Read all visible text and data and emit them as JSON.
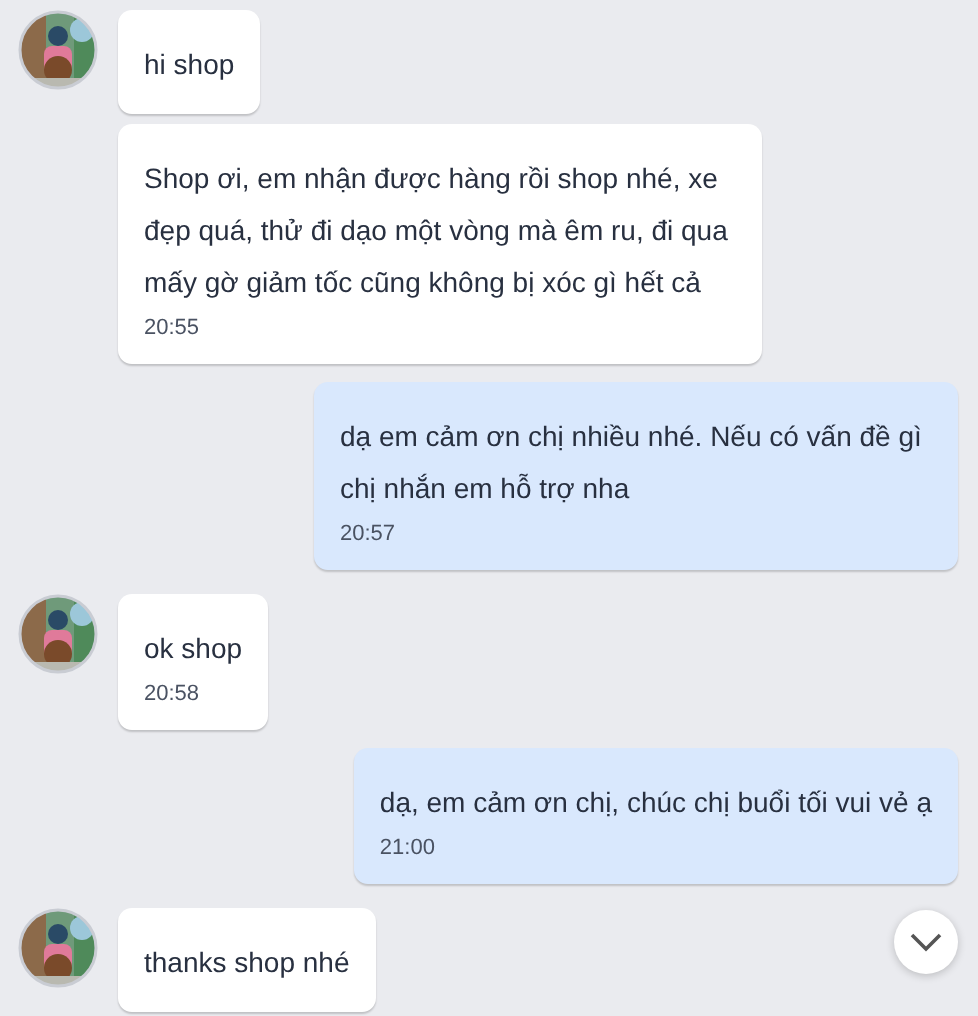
{
  "messages": [
    {
      "kind": "incoming",
      "avatar": true,
      "text": "hi shop"
    },
    {
      "kind": "incoming",
      "avatar": false,
      "text": "Shop ơi, em nhận được hàng rồi shop nhé, xe đẹp quá, thử đi dạo một vòng mà êm ru, đi qua mấy gờ giảm tốc cũng không bị xóc gì hết cả",
      "time": "20:55"
    },
    {
      "kind": "outgoing",
      "text": "dạ em cảm ơn chị nhiều nhé. Nếu có vấn đề gì chị nhắn em hỗ trợ nha",
      "time": "20:57"
    },
    {
      "kind": "incoming",
      "avatar": true,
      "text": "ok shop",
      "time": "20:58"
    },
    {
      "kind": "outgoing",
      "text": "dạ, em cảm ơn chị, chúc chị buổi tối vui vẻ ạ",
      "time": "21:00"
    },
    {
      "kind": "incoming",
      "avatar": true,
      "text": "thanks shop nhé"
    }
  ],
  "scroll_button": {
    "kind": "chevron-down"
  }
}
